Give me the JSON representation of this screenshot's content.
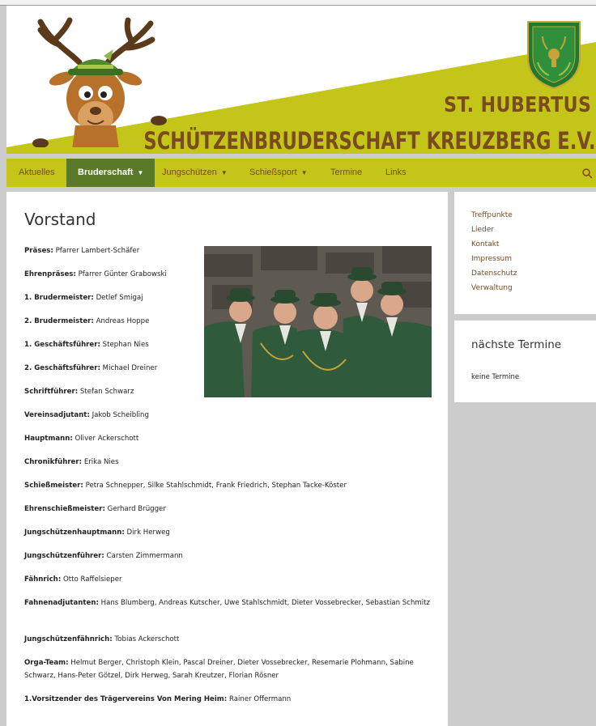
{
  "header": {
    "title_line1": "ST. HUBERTUS",
    "title_line2": "SCHÜTZENBRUDERSCHAFT KREUZBERG E.V.",
    "badge_text_top": "ST. HUBERTUS",
    "badge_text_bottom": "SCHÜTZENBRUDERSCHAFT KREUZBERG E.V.",
    "logo_icon": "deer-mascot-icon",
    "emblem_icon": "club-emblem-icon",
    "colors": {
      "accent": "#c3c618",
      "brand_brown": "#7b4a1e",
      "active_nav": "#5a7a2a"
    }
  },
  "nav": {
    "items": [
      {
        "label": "Aktuelles",
        "has_dropdown": false
      },
      {
        "label": "Bruderschaft",
        "has_dropdown": true,
        "active": true
      },
      {
        "label": "Jungschützen",
        "has_dropdown": true
      },
      {
        "label": "Schießsport",
        "has_dropdown": true
      },
      {
        "label": "Termine",
        "has_dropdown": false
      },
      {
        "label": "Links",
        "has_dropdown": false
      }
    ],
    "search_icon": "search-icon"
  },
  "main": {
    "title": "Vorstand",
    "entries": [
      {
        "role": "Präses",
        "names": "Pfarrer Lambert-Schäfer"
      },
      {
        "role": "Ehrenpräses",
        "names": "Pfarrer Günter Grabowski"
      },
      {
        "role": "1. Brudermeister",
        "names": "Detlef Smigaj"
      },
      {
        "role": "2. Brudermeister",
        "names": "Andreas Hoppe"
      },
      {
        "role": "1. Geschäftsführer",
        "names": "Stephan Nies"
      },
      {
        "role": "2. Geschäftsführer",
        "names": "Michael Dreiner"
      },
      {
        "role": "Schriftführer",
        "names": "Stefan Schwarz"
      },
      {
        "role": "Vereinsadjutant",
        "names": "Jakob Scheibling"
      },
      {
        "role": "Hauptmann",
        "names": "Oliver Ackerschott"
      },
      {
        "role": "Chronikführer",
        "names": "Erika Nies"
      },
      {
        "role": "Schießmeister",
        "names": "Petra Schnepper, Silke Stahlschmidt, Frank Friedrich, Stephan Tacke-Köster"
      },
      {
        "role": "Ehrenschießmeister",
        "names": "Gerhard Brügger"
      },
      {
        "role": "Jungschützenhauptmann",
        "names": "Dirk Herweg"
      },
      {
        "role": "Jungschützenführer",
        "names": "Carsten Zimmermann"
      },
      {
        "role": "Fähnrich",
        "names": "Otto Raffelsieper"
      },
      {
        "role": "Fahnenadjutanten",
        "names": "Hans Blumberg, Andreas Kutscher, Uwe Stahlschmidt, Dieter Vossebrecker, Sebastian Schmitz"
      },
      {
        "role": "Jungschützenfähnrich",
        "names": "Tobias Ackerschott"
      },
      {
        "role": "Orga-Team",
        "names": "Helmut Berger, Christoph Klein, Pascal Dreiner, Dieter Vossebrecker, Resemarie Plohmann, Sabine Schwarz, Hans-Peter Götzel, Dirk Herweg, Sarah Kreutzer, Florian Rösner"
      },
      {
        "role": "1.Vorsitzender des Trägervereins Von Mering Heim",
        "names": "Rainer Offermann"
      }
    ]
  },
  "sidebar": {
    "links": [
      "Treffpunkte",
      "Lieder",
      "Kontakt",
      "Impressum",
      "Datenschutz",
      "Verwaltung"
    ],
    "events_title": "nächste Termine",
    "events_empty": "keine Termine"
  }
}
